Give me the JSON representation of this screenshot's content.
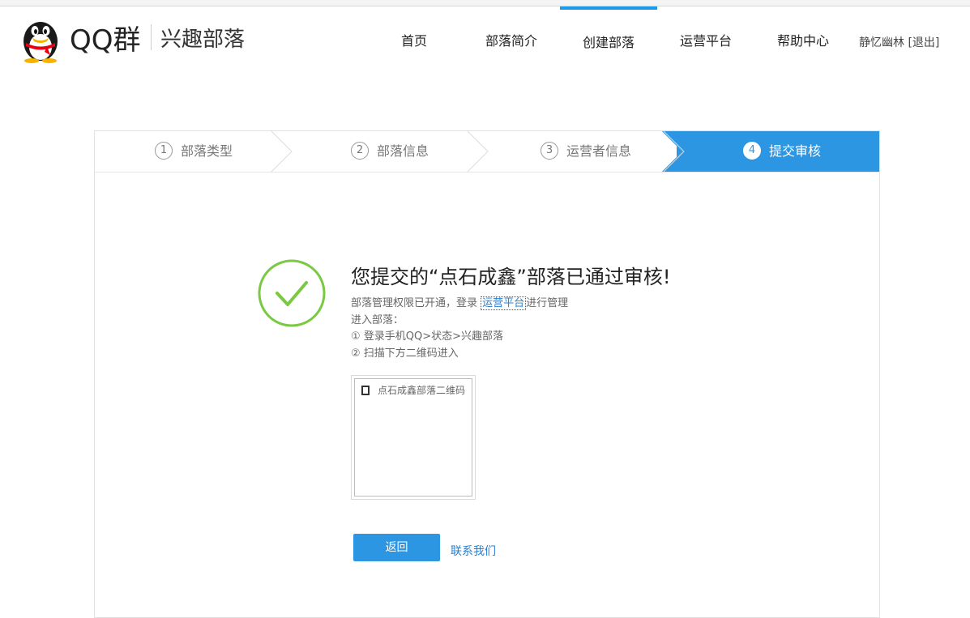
{
  "header": {
    "brand_qq": "QQ群",
    "brand_sub": "兴趣部落",
    "nav": [
      {
        "label": "首页"
      },
      {
        "label": "部落简介"
      },
      {
        "label": "创建部落",
        "active": true
      },
      {
        "label": "运营平台"
      },
      {
        "label": "帮助中心"
      }
    ],
    "user": {
      "name": "静忆幽林",
      "logout": "[退出]"
    }
  },
  "steps": [
    {
      "num": "1",
      "label": "部落类型"
    },
    {
      "num": "2",
      "label": "部落信息"
    },
    {
      "num": "3",
      "label": "运营者信息"
    },
    {
      "num": "4",
      "label": "提交审核",
      "active": true
    }
  ],
  "result": {
    "title": "您提交的“点石成鑫”部落已通过审核!",
    "line1_prefix": "部落管理权限已开通，登录",
    "line1_link": "运营平台",
    "line1_suffix": "进行管理",
    "line2": "进入部落：",
    "line3": "① 登录手机QQ>状态>兴趣部落",
    "line4": "② 扫描下方二维码进入",
    "qr_alt": "点石成鑫部落二维码"
  },
  "actions": {
    "back": "返回",
    "contact": "联系我们"
  },
  "colors": {
    "accent": "#2d96e3",
    "success": "#7ac943",
    "link": "#2b7fcf"
  }
}
